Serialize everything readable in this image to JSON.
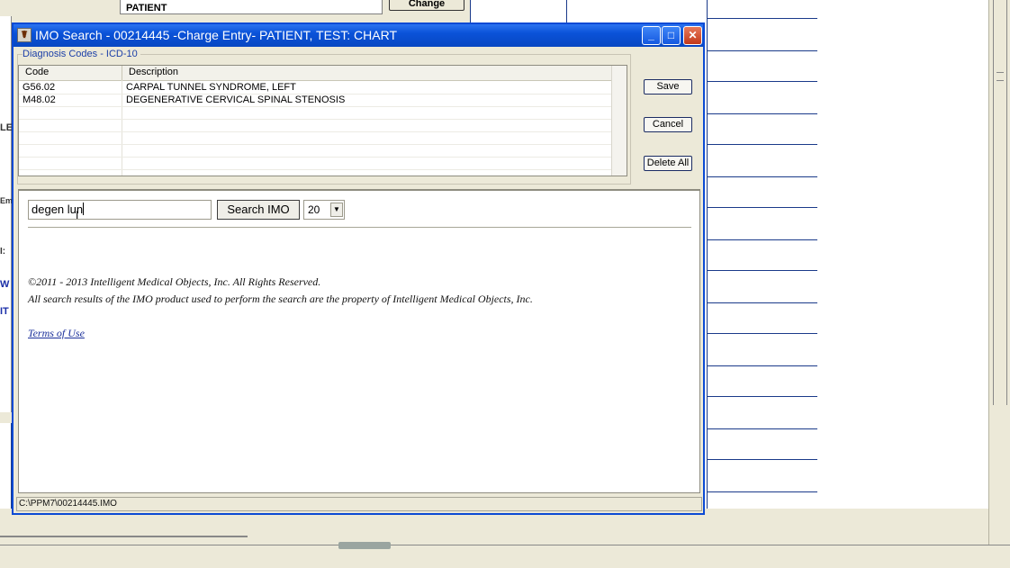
{
  "background_app": {
    "patient_field": "PATIENT",
    "change_button": "Change",
    "left_fragments": [
      "LE",
      "Em",
      "I:",
      "W",
      "IT"
    ]
  },
  "dialog": {
    "title": "IMO Search - 00214445  -Charge Entry- PATIENT, TEST: CHART",
    "group_label": "Diagnosis Codes - ICD-10",
    "table": {
      "columns": [
        "Code",
        "Description"
      ],
      "rows": [
        {
          "code": "G56.02",
          "description": "CARPAL TUNNEL SYNDROME, LEFT"
        },
        {
          "code": "M48.02",
          "description": "DEGENERATIVE CERVICAL SPINAL STENOSIS"
        }
      ]
    },
    "buttons": {
      "save": "Save",
      "cancel": "Cancel",
      "delete_all": "Delete All"
    },
    "search": {
      "query": "degen lun",
      "button": "Search IMO",
      "count": "20"
    },
    "legal": {
      "copyright": "©2011 - 2013 Intelligent Medical Objects, Inc. All Rights Reserved.",
      "notice": "All search results of the IMO product used to perform the search are the property of Intelligent Medical Objects, Inc.",
      "terms_link": "Terms of Use"
    },
    "status_path": "C:\\PPM7\\00214445.IMO"
  },
  "colors": {
    "title_bar": "#0a52d8",
    "link": "#1a2f9a",
    "window_face": "#ece9d8"
  }
}
